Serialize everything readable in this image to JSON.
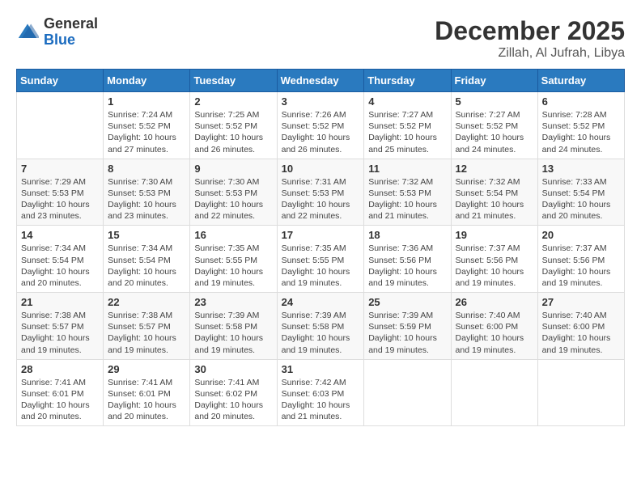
{
  "header": {
    "logo_general": "General",
    "logo_blue": "Blue",
    "month_title": "December 2025",
    "location": "Zillah, Al Jufrah, Libya"
  },
  "days_of_week": [
    "Sunday",
    "Monday",
    "Tuesday",
    "Wednesday",
    "Thursday",
    "Friday",
    "Saturday"
  ],
  "weeks": [
    [
      {
        "day": "",
        "info": ""
      },
      {
        "day": "1",
        "info": "Sunrise: 7:24 AM\nSunset: 5:52 PM\nDaylight: 10 hours\nand 27 minutes."
      },
      {
        "day": "2",
        "info": "Sunrise: 7:25 AM\nSunset: 5:52 PM\nDaylight: 10 hours\nand 26 minutes."
      },
      {
        "day": "3",
        "info": "Sunrise: 7:26 AM\nSunset: 5:52 PM\nDaylight: 10 hours\nand 26 minutes."
      },
      {
        "day": "4",
        "info": "Sunrise: 7:27 AM\nSunset: 5:52 PM\nDaylight: 10 hours\nand 25 minutes."
      },
      {
        "day": "5",
        "info": "Sunrise: 7:27 AM\nSunset: 5:52 PM\nDaylight: 10 hours\nand 24 minutes."
      },
      {
        "day": "6",
        "info": "Sunrise: 7:28 AM\nSunset: 5:52 PM\nDaylight: 10 hours\nand 24 minutes."
      }
    ],
    [
      {
        "day": "7",
        "info": "Sunrise: 7:29 AM\nSunset: 5:53 PM\nDaylight: 10 hours\nand 23 minutes."
      },
      {
        "day": "8",
        "info": "Sunrise: 7:30 AM\nSunset: 5:53 PM\nDaylight: 10 hours\nand 23 minutes."
      },
      {
        "day": "9",
        "info": "Sunrise: 7:30 AM\nSunset: 5:53 PM\nDaylight: 10 hours\nand 22 minutes."
      },
      {
        "day": "10",
        "info": "Sunrise: 7:31 AM\nSunset: 5:53 PM\nDaylight: 10 hours\nand 22 minutes."
      },
      {
        "day": "11",
        "info": "Sunrise: 7:32 AM\nSunset: 5:53 PM\nDaylight: 10 hours\nand 21 minutes."
      },
      {
        "day": "12",
        "info": "Sunrise: 7:32 AM\nSunset: 5:54 PM\nDaylight: 10 hours\nand 21 minutes."
      },
      {
        "day": "13",
        "info": "Sunrise: 7:33 AM\nSunset: 5:54 PM\nDaylight: 10 hours\nand 20 minutes."
      }
    ],
    [
      {
        "day": "14",
        "info": "Sunrise: 7:34 AM\nSunset: 5:54 PM\nDaylight: 10 hours\nand 20 minutes."
      },
      {
        "day": "15",
        "info": "Sunrise: 7:34 AM\nSunset: 5:54 PM\nDaylight: 10 hours\nand 20 minutes."
      },
      {
        "day": "16",
        "info": "Sunrise: 7:35 AM\nSunset: 5:55 PM\nDaylight: 10 hours\nand 19 minutes."
      },
      {
        "day": "17",
        "info": "Sunrise: 7:35 AM\nSunset: 5:55 PM\nDaylight: 10 hours\nand 19 minutes."
      },
      {
        "day": "18",
        "info": "Sunrise: 7:36 AM\nSunset: 5:56 PM\nDaylight: 10 hours\nand 19 minutes."
      },
      {
        "day": "19",
        "info": "Sunrise: 7:37 AM\nSunset: 5:56 PM\nDaylight: 10 hours\nand 19 minutes."
      },
      {
        "day": "20",
        "info": "Sunrise: 7:37 AM\nSunset: 5:56 PM\nDaylight: 10 hours\nand 19 minutes."
      }
    ],
    [
      {
        "day": "21",
        "info": "Sunrise: 7:38 AM\nSunset: 5:57 PM\nDaylight: 10 hours\nand 19 minutes."
      },
      {
        "day": "22",
        "info": "Sunrise: 7:38 AM\nSunset: 5:57 PM\nDaylight: 10 hours\nand 19 minutes."
      },
      {
        "day": "23",
        "info": "Sunrise: 7:39 AM\nSunset: 5:58 PM\nDaylight: 10 hours\nand 19 minutes."
      },
      {
        "day": "24",
        "info": "Sunrise: 7:39 AM\nSunset: 5:58 PM\nDaylight: 10 hours\nand 19 minutes."
      },
      {
        "day": "25",
        "info": "Sunrise: 7:39 AM\nSunset: 5:59 PM\nDaylight: 10 hours\nand 19 minutes."
      },
      {
        "day": "26",
        "info": "Sunrise: 7:40 AM\nSunset: 6:00 PM\nDaylight: 10 hours\nand 19 minutes."
      },
      {
        "day": "27",
        "info": "Sunrise: 7:40 AM\nSunset: 6:00 PM\nDaylight: 10 hours\nand 19 minutes."
      }
    ],
    [
      {
        "day": "28",
        "info": "Sunrise: 7:41 AM\nSunset: 6:01 PM\nDaylight: 10 hours\nand 20 minutes."
      },
      {
        "day": "29",
        "info": "Sunrise: 7:41 AM\nSunset: 6:01 PM\nDaylight: 10 hours\nand 20 minutes."
      },
      {
        "day": "30",
        "info": "Sunrise: 7:41 AM\nSunset: 6:02 PM\nDaylight: 10 hours\nand 20 minutes."
      },
      {
        "day": "31",
        "info": "Sunrise: 7:42 AM\nSunset: 6:03 PM\nDaylight: 10 hours\nand 21 minutes."
      },
      {
        "day": "",
        "info": ""
      },
      {
        "day": "",
        "info": ""
      },
      {
        "day": "",
        "info": ""
      }
    ]
  ]
}
